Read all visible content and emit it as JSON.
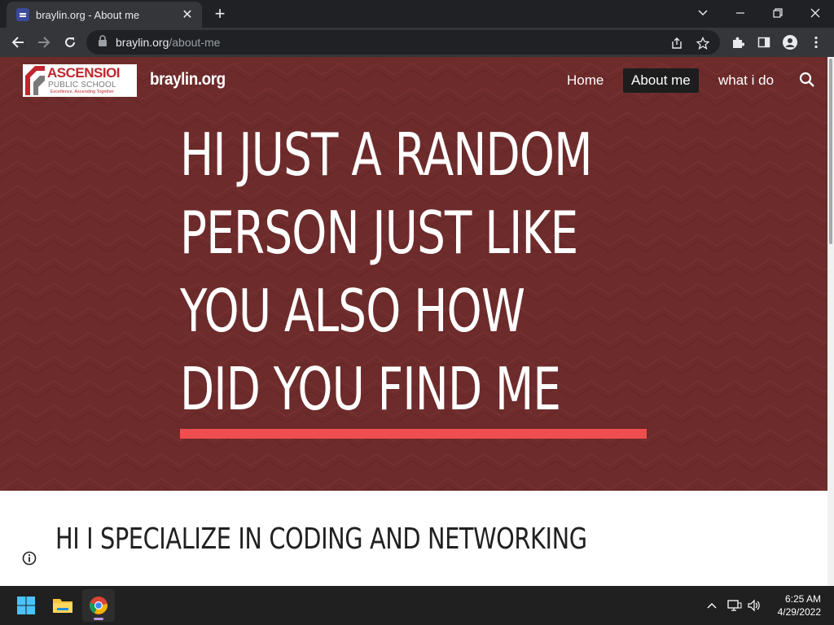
{
  "browser": {
    "tab_title": "braylin.org - About me",
    "url_host": "braylin.org",
    "url_path": "/about-me"
  },
  "site": {
    "logo": {
      "line1": "ASCENSIOI",
      "line2": "PUBLIC SCHOOL",
      "line3": "Excellence, Ascending Together"
    },
    "title": "braylin.org",
    "nav": [
      "Home",
      "About me",
      "what i do"
    ],
    "active_nav": "About me"
  },
  "hero": {
    "lines": [
      "HI JUST A RANDOM",
      "PERSON JUST LIKE",
      "YOU ALSO HOW",
      "DID YOU FIND ME"
    ]
  },
  "section": {
    "title": "HI I SPECIALIZE IN CODING AND NETWORKING"
  },
  "taskbar": {
    "time": "6:25 AM",
    "date": "4/29/2022"
  },
  "colors": {
    "hero_bg": "#6d2b2b",
    "accent_line": "#f04e4e",
    "browser_frame": "#202124"
  }
}
